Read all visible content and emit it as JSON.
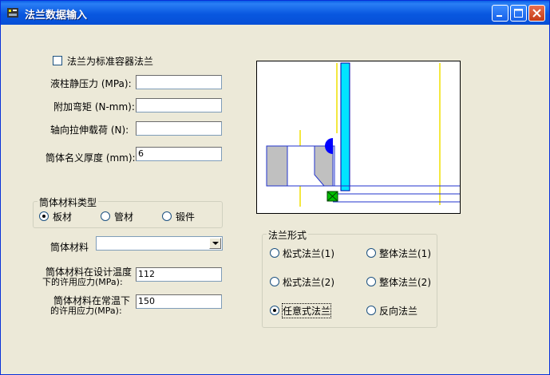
{
  "window": {
    "title": "法兰数据输入"
  },
  "form": {
    "standard_checkbox_label": "法兰为标准容器法兰",
    "standard_checked": false,
    "pressure_label": "液柱静压力 (MPa):",
    "pressure_value": "",
    "moment_label": "附加弯矩 (N-mm):",
    "moment_value": "",
    "axial_label": "轴向拉伸载荷 (N):",
    "axial_value": "",
    "thickness_label": "筒体名义厚度 (mm):",
    "thickness_value": "6"
  },
  "material_type": {
    "title": "筒体材料类型",
    "options": [
      "板材",
      "管材",
      "锻件"
    ],
    "selected": "板材"
  },
  "material": {
    "label": "筒体材料",
    "value": "",
    "design_stress_label_1": "筒体材料在设计温度",
    "design_stress_label_2": "下的许用应力(MPa):",
    "design_stress_value": "112",
    "ambient_stress_label_1": "筒体材料在常温下",
    "ambient_stress_label_2": "的许用应力(MPa):",
    "ambient_stress_value": "150"
  },
  "flange_type": {
    "title": "法兰形式",
    "options": [
      "松式法兰(1)",
      "整体法兰(1)",
      "松式法兰(2)",
      "整体法兰(2)",
      "任意式法兰",
      "反向法兰"
    ],
    "selected": "任意式法兰"
  },
  "colors": {
    "titlebar": "#0a5fe6",
    "background": "#ece9d8",
    "shell_cyan": "#00e5ff",
    "weld_green": "#00c000",
    "nut_blue": "#0000ff",
    "centerline_yellow": "#f0e000"
  }
}
